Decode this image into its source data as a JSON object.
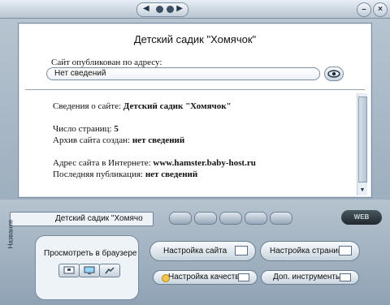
{
  "window": {
    "title_controls": {
      "left": "◀",
      "right": "▶"
    },
    "min_label": "–",
    "close_label": "×"
  },
  "site": {
    "title": "Детский садик \"Хомячок\"",
    "published_label": "Сайт опубликован по адресу:",
    "published_value": "Нет сведений",
    "info": {
      "about_label": "Сведения о сайте: ",
      "about_value": "Детский садик \"Хомячок\"",
      "pages_label": "Число страниц: ",
      "pages_value": "5",
      "archive_label": "Архив сайта создан: ",
      "archive_value": "нет сведений",
      "address_label": "Адрес сайта в Интернете: ",
      "address_value": "www.hamster.baby-host.ru",
      "last_pub_label": "Последняя публикация: ",
      "last_pub_value": "нет сведений"
    }
  },
  "bottom": {
    "name_label": "Название",
    "name_value": "Детский садик \"Хомячо",
    "browser_preview": "Просмотреть в браузере",
    "site_settings": "Настройка сайта",
    "page_settings": "Настройка страниц",
    "quality_settings": "Настройка качества",
    "tools": "Доп. инструменты",
    "web_label": "WEB"
  },
  "icons": {
    "eye": "eye-icon",
    "monitor": "monitor-icon",
    "gear": "gear-icon"
  }
}
